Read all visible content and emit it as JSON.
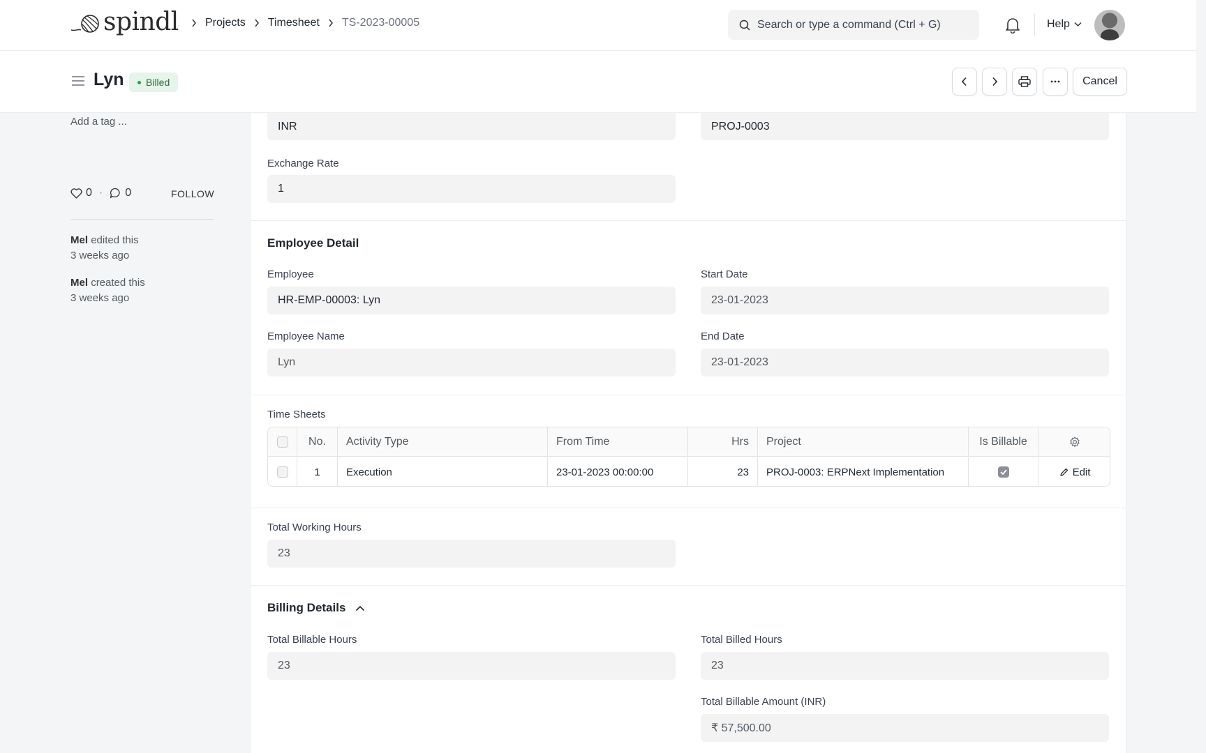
{
  "navbar": {
    "logo_text": "spindl",
    "breadcrumbs": [
      "Projects",
      "Timesheet",
      "TS-2023-00005"
    ],
    "search_placeholder": "Search or type a command (Ctrl + G)",
    "help_label": "Help"
  },
  "header": {
    "title": "Lyn",
    "status": "Billed",
    "status_color": "#2d9a4a",
    "cancel_label": "Cancel"
  },
  "sidebar": {
    "add_tag": "Add a tag ...",
    "likes": "0",
    "comments": "0",
    "follow": "FOLLOW",
    "activity": [
      {
        "user": "Mel",
        "action": "edited this",
        "time": "3 weeks ago"
      },
      {
        "user": "Mel",
        "action": "created this",
        "time": "3 weeks ago"
      }
    ]
  },
  "form": {
    "currency": "INR",
    "project": "PROJ-0003",
    "exchange_rate_label": "Exchange Rate",
    "exchange_rate": "1",
    "employee_section": "Employee Detail",
    "employee_label": "Employee",
    "employee": "HR-EMP-00003: Lyn",
    "start_date_label": "Start Date",
    "start_date": "23-01-2023",
    "employee_name_label": "Employee Name",
    "employee_name": "Lyn",
    "end_date_label": "End Date",
    "end_date": "23-01-2023",
    "time_sheets_label": "Time Sheets",
    "total_working_hours_label": "Total Working Hours",
    "total_working_hours": "23",
    "billing_section": "Billing Details",
    "total_billable_hours_label": "Total Billable Hours",
    "total_billable_hours": "23",
    "total_billed_hours_label": "Total Billed Hours",
    "total_billed_hours": "23",
    "total_billable_amount_label": "Total Billable Amount (INR)",
    "total_billable_amount": "₹ 57,500.00"
  },
  "time_sheets": {
    "columns": [
      "No.",
      "Activity Type",
      "From Time",
      "Hrs",
      "Project",
      "Is Billable"
    ],
    "rows": [
      {
        "no": "1",
        "activity_type": "Execution",
        "from_time": "23-01-2023 00:00:00",
        "hrs": "23",
        "project": "PROJ-0003: ERPNext Implementation",
        "is_billable": true
      }
    ],
    "edit_label": "Edit"
  }
}
